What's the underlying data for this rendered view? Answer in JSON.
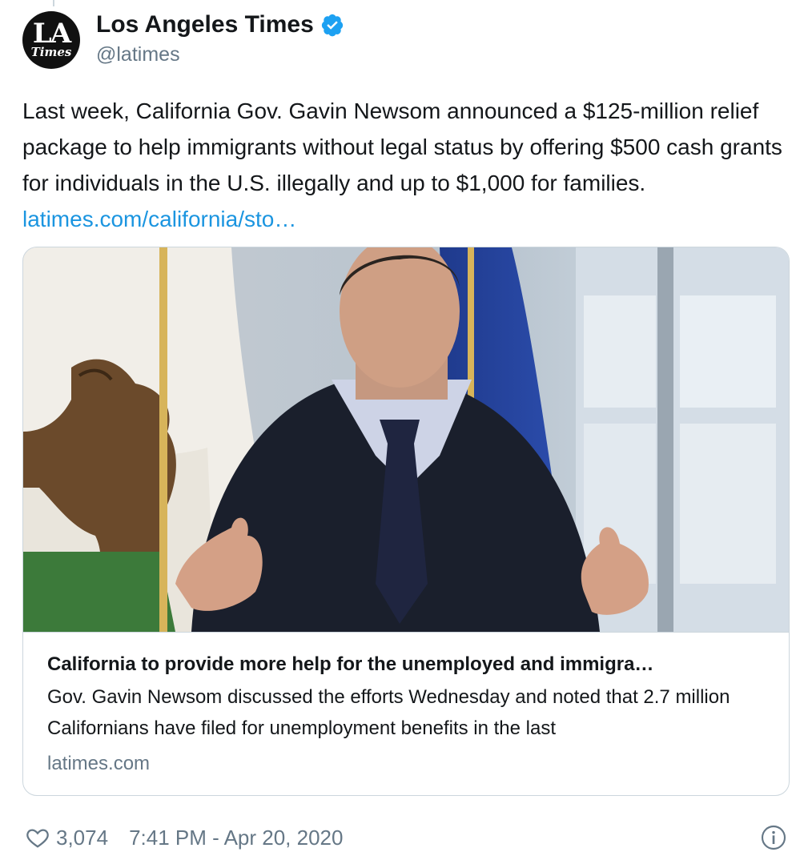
{
  "account": {
    "display_name": "Los Angeles Times",
    "handle": "@latimes",
    "avatar_text_top": "LA",
    "avatar_text_bottom": "Times",
    "verified_icon": "verified-badge-icon"
  },
  "tweet": {
    "text": "Last week, California Gov. Gavin Newsom announced a $125-million relief package to help immigrants without legal status by offering $500 cash grants for individuals in the U.S. illegally and up to $1,000 for families.",
    "link_text": "latimes.com/california/sto…"
  },
  "card": {
    "image_subject": "photo of Gov. Gavin Newsom speaking in front of California flag",
    "title": "California to provide more help for the unemployed and immigra…",
    "description": "Gov. Gavin Newsom discussed the efforts Wednesday and noted that 2.7 million Californians have filed for unemployment benefits in the last",
    "domain": "latimes.com"
  },
  "footer": {
    "like_count": "3,074",
    "timestamp": "7:41 PM - Apr 20, 2020",
    "like_icon": "heart-icon",
    "info_icon": "info-icon"
  },
  "colors": {
    "link": "#1b95e0",
    "verified": "#1da1f2",
    "secondary_text": "#657786",
    "border": "#ccd6dd"
  }
}
